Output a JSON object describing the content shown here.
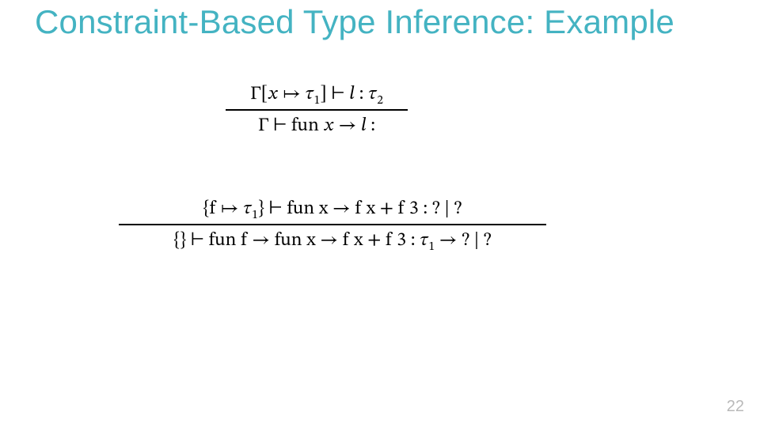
{
  "title": "Constraint-Based Type Inference: Example",
  "rule1": {
    "n_a": "Γ[𝑥 ↦ 𝜏",
    "n_sub1": "1",
    "n_b": "] ⊢ 𝑙 : 𝜏",
    "n_sub2": "2",
    "d_a": "Γ ⊢ fun 𝑥 → 𝑙 :"
  },
  "rule2": {
    "n_a": "{f ↦ 𝜏",
    "n_sub1": "1",
    "n_b": "} ⊢ fun x → f x + f 3 : ? | ?",
    "d_a": "{} ⊢ fun f → fun x → f x + f 3 : 𝜏",
    "d_sub1": "1",
    "d_b": " → ? | ?"
  },
  "page_number": "22"
}
